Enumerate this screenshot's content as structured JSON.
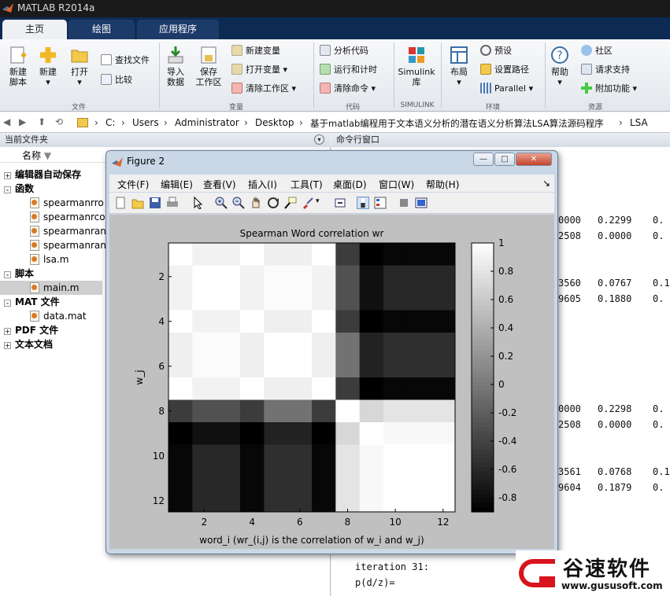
{
  "window": {
    "title": "MATLAB R2014a"
  },
  "tabs": [
    {
      "label": "主页",
      "active": true
    },
    {
      "label": "绘图",
      "active": false
    },
    {
      "label": "应用程序",
      "active": false
    }
  ],
  "ribbon": {
    "new_script": "新建\n脚本",
    "new": "新建",
    "open": "打开",
    "find_files": "查找文件",
    "compare": "比较",
    "group_file": "文件",
    "import_data": "导入\n数据",
    "save_workspace": "保存\n工作区",
    "new_variable": "新建变量",
    "open_variable": "打开变量",
    "clear_workspace": "清除工作区",
    "group_variable": "变量",
    "analyze_code": "分析代码",
    "run_and_time": "运行和计时",
    "clear_commands": "清除命令",
    "group_code": "代码",
    "simulink_library": "Simulink\n库",
    "group_simulink": "SIMULINK",
    "layout": "布局",
    "preferences": "预设",
    "set_path": "设置路径",
    "parallel": "Parallel",
    "group_environment": "环境",
    "help": "帮助",
    "community": "社区",
    "request_support": "请求支持",
    "add_ons": "附加功能",
    "group_resources": "资源"
  },
  "address": {
    "crumbs": [
      "C:",
      "Users",
      "Administrator",
      "Desktop",
      "基于matlab编程用于文本语义分析的潜在语义分析算法LSA算法源码程序",
      "LSA"
    ]
  },
  "current_folder": {
    "title": "当前文件夹",
    "column_name": "名称",
    "tree": [
      {
        "label": "编辑器自动保存",
        "bold": true,
        "pm": "+"
      },
      {
        "label": "函数",
        "bold": true,
        "pm": "-"
      },
      {
        "label": "spearmanrro",
        "file": true
      },
      {
        "label": "spearmanrco",
        "file": true
      },
      {
        "label": "spearmanran",
        "file": true
      },
      {
        "label": "spearmanran",
        "file": true
      },
      {
        "label": "lsa.m",
        "file": true
      },
      {
        "label": "脚本",
        "bold": true,
        "pm": "-"
      },
      {
        "label": "main.m",
        "file": true,
        "selected": true
      },
      {
        "label": "MAT 文件",
        "bold": true,
        "pm": "-"
      },
      {
        "label": "data.mat",
        "file": true
      },
      {
        "label": "PDF 文件",
        "bold": true,
        "pm": "+"
      },
      {
        "label": "文本文档",
        "bold": true,
        "pm": "+"
      }
    ]
  },
  "command_window": {
    "title": "命令行窗口",
    "lines": [
      {
        "c1": "0000",
        "c2": "0.2299",
        "c3": "0."
      },
      {
        "c1": "2508",
        "c2": "0.0000",
        "c3": "0."
      },
      {
        "c1": "3560",
        "c2": "0.0767",
        "c3": "0.1"
      },
      {
        "c1": "9605",
        "c2": "0.1880",
        "c3": "0."
      },
      {
        "c1": "0000",
        "c2": "0.2298",
        "c3": "0."
      },
      {
        "c1": "2508",
        "c2": "0.0000",
        "c3": "0."
      },
      {
        "c1": "3561",
        "c2": "0.0768",
        "c3": "0.1"
      },
      {
        "c1": "9604",
        "c2": "0.1879",
        "c3": "0."
      }
    ],
    "iteration": "iteration 31:",
    "prob": "p(d/z)="
  },
  "figure": {
    "title": "Figure 2",
    "menu": [
      "文件(F)",
      "编辑(E)",
      "查看(V)",
      "插入(I)",
      "工具(T)",
      "桌面(D)",
      "窗口(W)",
      "帮助(H)"
    ],
    "min": "—",
    "max": "□",
    "close": "✕"
  },
  "icons": [
    "matlab-logo-icon",
    "new-script-icon",
    "new-icon",
    "open-folder-icon",
    "find-files-icon",
    "compare-icon",
    "import-icon",
    "save-workspace-icon",
    "new-variable-icon",
    "open-variable-icon",
    "clear-workspace-icon",
    "analyze-code-icon",
    "run-time-icon",
    "clear-commands-icon",
    "simulink-icon",
    "layout-icon",
    "gear-icon",
    "set-path-icon",
    "parallel-icon",
    "help-icon",
    "community-icon",
    "request-support-icon",
    "add-ons-icon",
    "back-icon",
    "forward-icon",
    "up-folder-icon",
    "browse-icon",
    "folder-icon"
  ],
  "chart_data": {
    "type": "heatmap",
    "title": "Spearman Word correlation wr",
    "xlabel": "word_i (wr_(i,j) is the correlation of w_i and w_j)",
    "ylabel": "w_j",
    "x_ticks": [
      2,
      4,
      6,
      8,
      10,
      12
    ],
    "y_ticks": [
      2,
      4,
      6,
      8,
      10,
      12
    ],
    "colorbar_ticks": [
      1,
      0.8,
      0.6,
      0.4,
      0.2,
      0,
      -0.2,
      -0.4,
      -0.6,
      -0.8
    ],
    "clim": [
      -0.9,
      1
    ],
    "colormap": "gray",
    "matrix": [
      [
        1.0,
        0.9,
        0.9,
        1.0,
        0.88,
        0.88,
        1.0,
        -0.45,
        -0.9,
        -0.85,
        -0.85,
        -0.85
      ],
      [
        0.9,
        1.0,
        1.0,
        0.9,
        0.97,
        0.97,
        0.9,
        -0.3,
        -0.78,
        -0.6,
        -0.6,
        -0.6
      ],
      [
        0.9,
        1.0,
        1.0,
        0.9,
        0.97,
        0.97,
        0.9,
        -0.3,
        -0.78,
        -0.6,
        -0.6,
        -0.6
      ],
      [
        1.0,
        0.9,
        0.9,
        1.0,
        0.88,
        0.88,
        1.0,
        -0.45,
        -0.9,
        -0.85,
        -0.85,
        -0.85
      ],
      [
        0.88,
        0.97,
        0.97,
        0.88,
        1.0,
        1.0,
        0.88,
        -0.05,
        -0.65,
        -0.55,
        -0.55,
        -0.55
      ],
      [
        0.88,
        0.97,
        0.97,
        0.88,
        1.0,
        1.0,
        0.88,
        -0.05,
        -0.65,
        -0.55,
        -0.55,
        -0.55
      ],
      [
        1.0,
        0.9,
        0.9,
        1.0,
        0.88,
        0.88,
        1.0,
        -0.45,
        -0.9,
        -0.85,
        -0.85,
        -0.85
      ],
      [
        -0.45,
        -0.3,
        -0.3,
        -0.45,
        -0.05,
        -0.05,
        -0.45,
        1.0,
        0.7,
        0.8,
        0.8,
        0.8
      ],
      [
        -0.9,
        -0.78,
        -0.78,
        -0.9,
        -0.65,
        -0.65,
        -0.9,
        0.7,
        1.0,
        0.95,
        0.95,
        0.95
      ],
      [
        -0.85,
        -0.6,
        -0.6,
        -0.85,
        -0.55,
        -0.55,
        -0.85,
        0.8,
        0.95,
        1.0,
        1.0,
        1.0
      ],
      [
        -0.85,
        -0.6,
        -0.6,
        -0.85,
        -0.55,
        -0.55,
        -0.85,
        0.8,
        0.95,
        1.0,
        1.0,
        1.0
      ],
      [
        -0.85,
        -0.6,
        -0.6,
        -0.85,
        -0.55,
        -0.55,
        -0.85,
        0.8,
        0.95,
        1.0,
        1.0,
        1.0
      ]
    ]
  },
  "watermark": {
    "brand": "谷速软件",
    "url": "www.gususoft.com"
  }
}
